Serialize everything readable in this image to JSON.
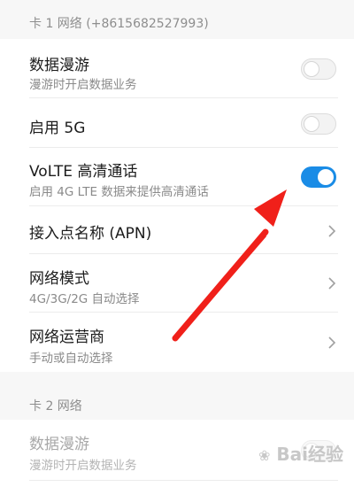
{
  "sim1": {
    "header": "卡 1 网络 (+8615682527993)",
    "items": [
      {
        "title": "数据漫游",
        "subtitle": "漫游时开启数据业务",
        "control": "toggle",
        "checked": false
      },
      {
        "title": "启用 5G",
        "subtitle": "",
        "control": "toggle",
        "checked": false
      },
      {
        "title": "VoLTE 高清通话",
        "subtitle": "启用 4G LTE 数据来提供高清通话",
        "control": "toggle",
        "checked": true
      },
      {
        "title": "接入点名称 (APN)",
        "subtitle": "",
        "control": "chevron"
      },
      {
        "title": "网络模式",
        "subtitle": "4G/3G/2G 自动选择",
        "control": "chevron"
      },
      {
        "title": "网络运营商",
        "subtitle": "手动或自动选择",
        "control": "chevron"
      }
    ]
  },
  "sim2": {
    "header": "卡 2 网络",
    "items": [
      {
        "title": "数据漫游",
        "subtitle": "漫游时开启数据业务",
        "control": "toggle",
        "checked": false
      }
    ]
  },
  "watermark": {
    "text": "Bai经验",
    "icon": "baidu-paw-icon"
  },
  "colors": {
    "accent": "#1a8ce6",
    "arrow": "#f0201a",
    "background": "#f7f7f7"
  }
}
